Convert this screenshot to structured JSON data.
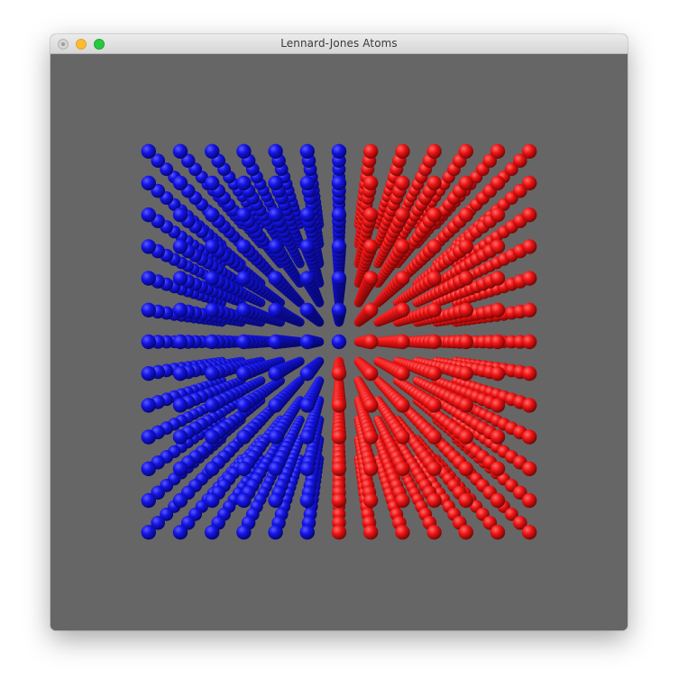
{
  "window": {
    "title": "Lennard-Jones Atoms"
  },
  "scene": {
    "background_color": "#666666",
    "atom_colors": {
      "blue": "#1010d8",
      "red": "#e01010"
    }
  }
}
